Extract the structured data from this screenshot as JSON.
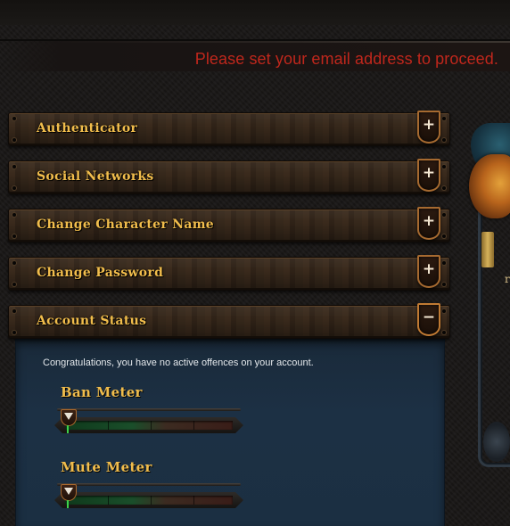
{
  "notice": {
    "text": "Please set your email address to proceed.",
    "color": "#c0271c"
  },
  "accordion": {
    "items": [
      {
        "label": "Authenticator",
        "toggle": "+",
        "expanded": false
      },
      {
        "label": "Social Networks",
        "toggle": "+",
        "expanded": false
      },
      {
        "label": "Change Character Name",
        "toggle": "+",
        "expanded": false
      },
      {
        "label": "Change Password",
        "toggle": "+",
        "expanded": false
      },
      {
        "label": "Account Status",
        "toggle": "−",
        "expanded": true
      }
    ],
    "label_color": "#f1bd4c"
  },
  "account_status": {
    "message": "Congratulations, you have no active offences on your account.",
    "meters": [
      {
        "title": "Ban Meter",
        "level": 0
      },
      {
        "title": "Mute Meter",
        "level": 0
      }
    ]
  },
  "icons": {
    "expand": "plus-icon",
    "collapse": "minus-icon",
    "meter_indicator": "triangle-down-icon",
    "ornament": "dragon-emblem-icon"
  },
  "ornament": {
    "glyph": "r"
  }
}
